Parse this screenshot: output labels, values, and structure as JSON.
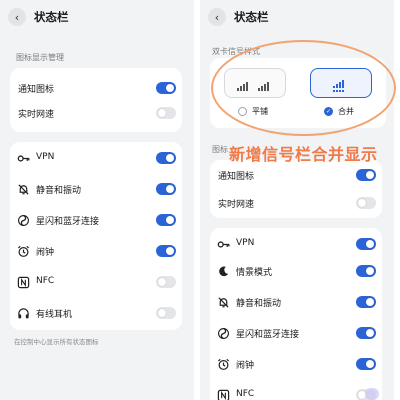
{
  "colors": {
    "accent": "#2a64d6",
    "toggle_off": "#e3e5e8",
    "annotation": "#f07a48",
    "oval": "#f2a372",
    "background": "#f1f3f5"
  },
  "left": {
    "title": "状态栏",
    "back_icon": "chevron-left-icon",
    "section_icons_label": "图标显示管理",
    "group1": [
      {
        "label": "通知图标",
        "on": true
      },
      {
        "label": "实时网速",
        "on": false
      }
    ],
    "group2": [
      {
        "icon": "key-icon",
        "label": "VPN",
        "on": true
      },
      {
        "icon": "bell-mute-icon",
        "label": "静音和振动",
        "on": true
      },
      {
        "icon": "link-icon",
        "label": "星闪和蓝牙连接",
        "on": true
      },
      {
        "icon": "alarm-icon",
        "label": "闹钟",
        "on": true
      },
      {
        "icon": "nfc-icon",
        "label": "NFC",
        "on": false
      },
      {
        "icon": "headphones-icon",
        "label": "有线耳机",
        "on": false
      }
    ],
    "footer": "在控制中心显示所有状态图标"
  },
  "right": {
    "title": "状态栏",
    "back_icon": "chevron-left-icon",
    "section_dual_sim": "双卡信号样式",
    "options": [
      {
        "label": "平铺",
        "selected": false
      },
      {
        "label": "合并",
        "selected": true
      }
    ],
    "annotation": "新增信号栏合并显示",
    "section_icons_label_partial": "图标",
    "group1": [
      {
        "label": "通知图标",
        "on": true
      },
      {
        "label": "实时网速",
        "on": false
      }
    ],
    "group2": [
      {
        "icon": "key-icon",
        "label": "VPN",
        "on": true
      },
      {
        "icon": "moon-icon",
        "label": "情景模式",
        "on": true
      },
      {
        "icon": "bell-mute-icon",
        "label": "静音和振动",
        "on": true
      },
      {
        "icon": "link-icon",
        "label": "星闪和蓝牙连接",
        "on": true
      },
      {
        "icon": "alarm-icon",
        "label": "闹钟",
        "on": true
      },
      {
        "icon": "nfc-icon",
        "label": "NFC",
        "on": false
      }
    ]
  }
}
